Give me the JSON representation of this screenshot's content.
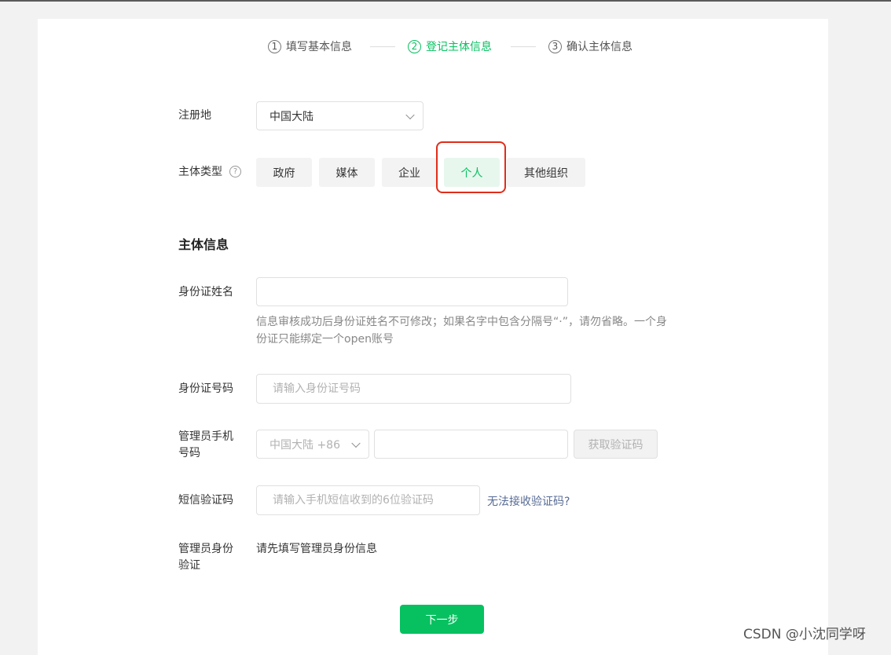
{
  "steps": [
    {
      "num": "1",
      "label": "填写基本信息"
    },
    {
      "num": "2",
      "label": "登记主体信息"
    },
    {
      "num": "3",
      "label": "确认主体信息"
    }
  ],
  "registration": {
    "label": "注册地",
    "value": "中国大陆"
  },
  "entity_type": {
    "label": "主体类型",
    "help_glyph": "?",
    "options": [
      "政府",
      "媒体",
      "企业",
      "个人",
      "其他组织"
    ],
    "selected": "个人"
  },
  "section_title": "主体信息",
  "id_name": {
    "label": "身份证姓名",
    "value": "",
    "hint_line1": "信息审核成功后身份证姓名不可修改；如果名字中包含分隔号“·”，请勿省略。一个身",
    "hint_line2": "份证只能绑定一个open账号"
  },
  "id_number": {
    "label": "身份证号码",
    "placeholder": "请输入身份证号码"
  },
  "admin_phone": {
    "label_line1": "管理员手机",
    "label_line2": "号码",
    "country_code": "中国大陆 +86",
    "value": "",
    "get_code_label": "获取验证码"
  },
  "sms_code": {
    "label": "短信验证码",
    "placeholder": "请输入手机短信收到的6位验证码",
    "cannot_receive_link": "无法接收验证码?"
  },
  "admin_verify": {
    "label_line1": "管理员身份",
    "label_line2": "验证",
    "text": "请先填写管理员身份信息"
  },
  "next_button": "下一步",
  "watermark": "CSDN @小沈同学呀",
  "colors": {
    "accent": "#07c160",
    "link": "#576b95",
    "highlight": "#e02d1a"
  }
}
